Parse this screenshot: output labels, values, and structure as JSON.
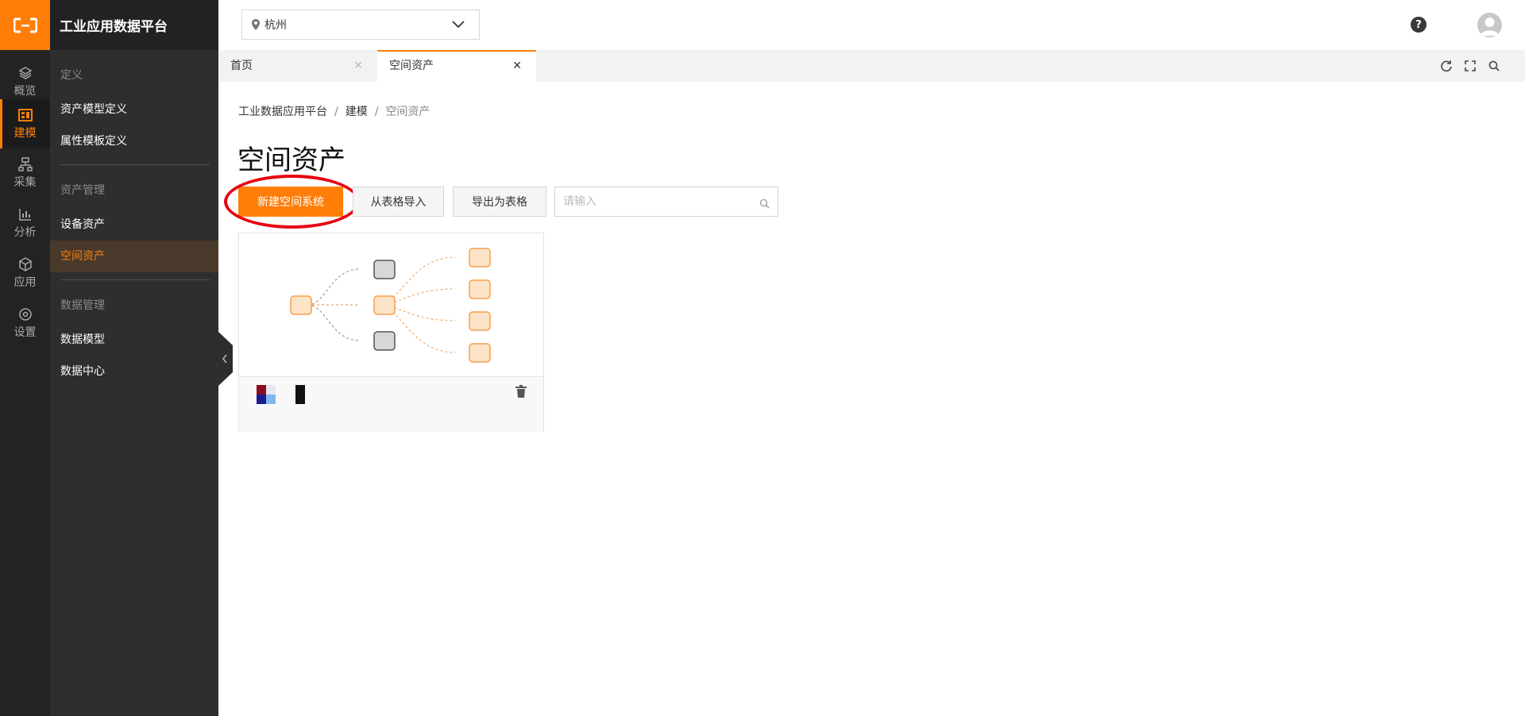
{
  "app": {
    "title": "工业应用数据平台",
    "accent_color": "#ff7e08"
  },
  "rail": {
    "logo_icon": "aliyun-logo-icon",
    "items": [
      {
        "label": "概览",
        "icon": "layers-icon"
      },
      {
        "label": "建模",
        "icon": "modeling-icon",
        "active": true
      },
      {
        "label": "采集",
        "icon": "collect-icon"
      },
      {
        "label": "分析",
        "icon": "chart-icon"
      },
      {
        "label": "应用",
        "icon": "cube-icon"
      },
      {
        "label": "设置",
        "icon": "gear-icon"
      }
    ]
  },
  "sidebar": {
    "sections": [
      {
        "title": "定义",
        "items": [
          "资产模型定义",
          "属性模板定义"
        ]
      },
      {
        "title": "资产管理",
        "items": [
          "设备资产",
          "空间资产"
        ]
      },
      {
        "title": "数据管理",
        "items": [
          "数据模型",
          "数据中心"
        ]
      }
    ],
    "active_item": "空间资产"
  },
  "topbar": {
    "city": "杭州",
    "help_icon": "help-icon",
    "avatar_icon": "user-avatar-icon"
  },
  "tabs": [
    {
      "label": "首页",
      "active": false
    },
    {
      "label": "空间资产",
      "active": true
    }
  ],
  "toolbar_icons": [
    "refresh-icon",
    "fullscreen-icon",
    "search-icon"
  ],
  "breadcrumb": [
    "工业数据应用平台",
    "建模",
    "空间资产"
  ],
  "page_title": "空间资产",
  "actions": {
    "create_label": "新建空间系统",
    "import_label": "从表格导入",
    "export_label": "导出为表格",
    "search_placeholder": "请输入"
  },
  "card": {
    "diagram_icon": "space-system-topology-icon",
    "delete_icon": "trash-icon"
  }
}
